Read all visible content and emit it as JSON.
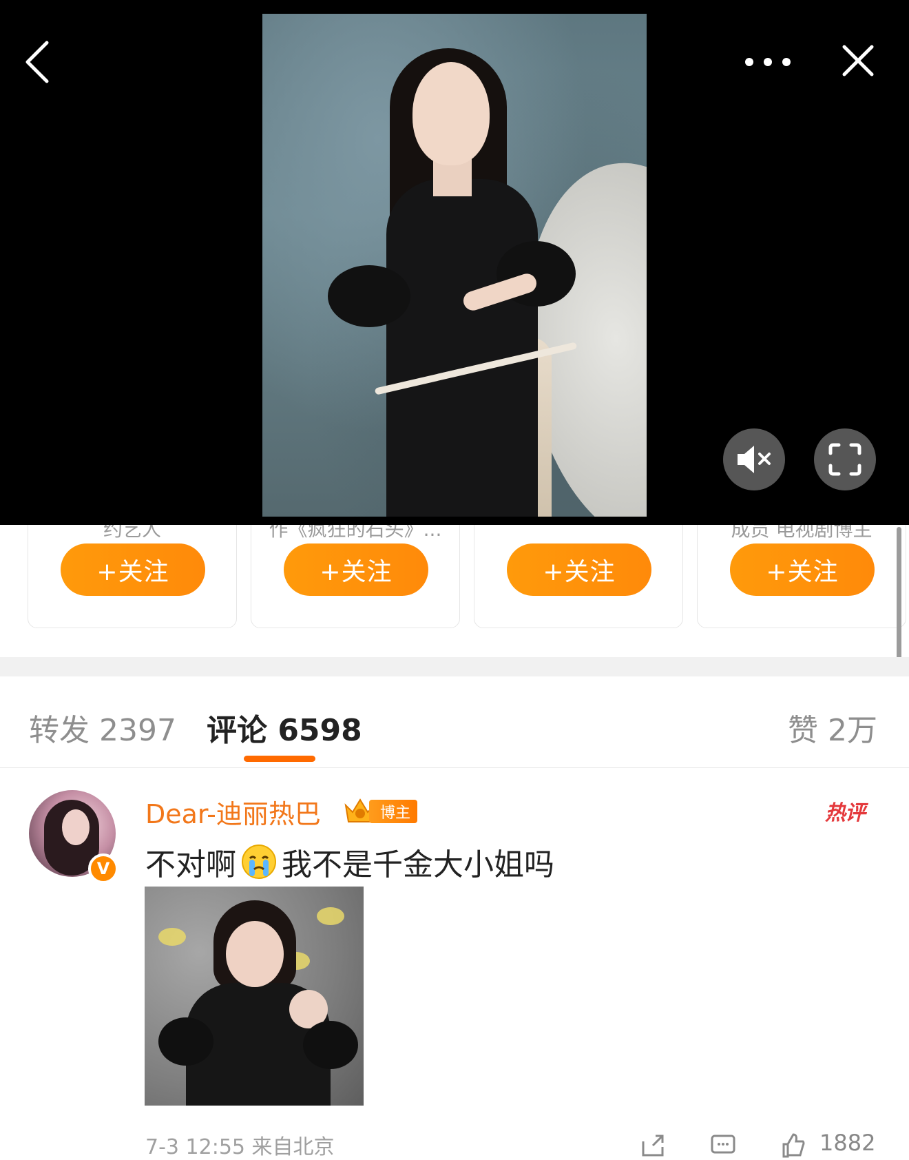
{
  "video": {
    "description_icons": [
      "back-icon",
      "more-icon",
      "close-icon",
      "mute-icon",
      "fullscreen-icon"
    ]
  },
  "recommendations": [
    {
      "desc": "约艺人",
      "follow_label": "+关注"
    },
    {
      "desc": "作《疯狂的石头》...",
      "follow_label": "+关注"
    },
    {
      "desc": "",
      "follow_label": "+关注"
    },
    {
      "desc": "成员 电视剧博主",
      "follow_label": "+关注"
    }
  ],
  "tabs": {
    "repost": "转发 2397",
    "comment": "评论 6598",
    "like": "赞 2万"
  },
  "comment": {
    "username": "Dear-迪丽热巴",
    "badge": "博主",
    "verified": "V",
    "hot_label": "热评",
    "text_before_emoji": "不对啊",
    "text_after_emoji": "我不是千金大小姐吗",
    "meta": "7-3 12:55  来自北京",
    "like_count": "1882"
  },
  "colors": {
    "accent": "#ff8a0a",
    "username": "#f2771a",
    "hot": "#e4393c",
    "tab_underline": "#ff6a00"
  }
}
